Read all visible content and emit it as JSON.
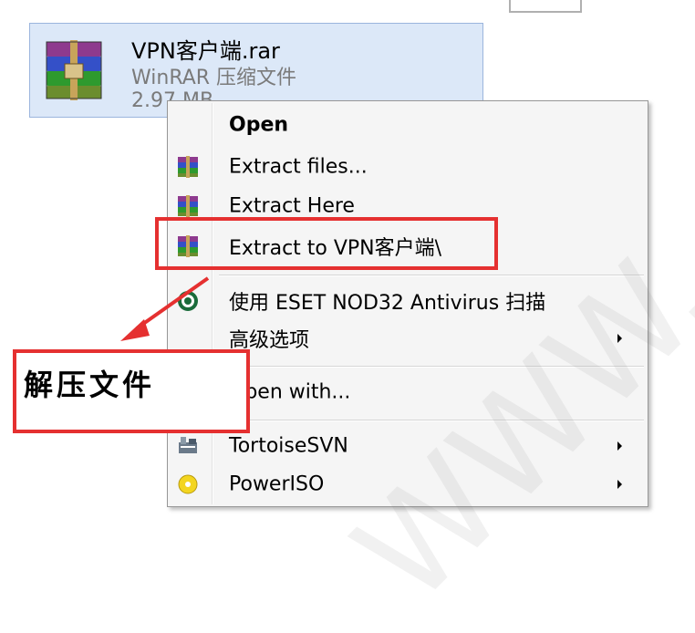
{
  "file": {
    "name": "VPN客户端.rar",
    "type": "WinRAR 压缩文件",
    "size": "2.97 MB",
    "icon": "winrar-archive-icon"
  },
  "context_menu": {
    "items": [
      {
        "label": "Open",
        "bold": true
      },
      {
        "label": "Extract files...",
        "icon": "winrar-icon"
      },
      {
        "label": "Extract Here",
        "icon": "winrar-icon"
      },
      {
        "label": "Extract to VPN客户端\\",
        "icon": "winrar-icon"
      },
      {
        "label": "使用 ESET NOD32 Antivirus 扫描",
        "icon": "eset-icon"
      },
      {
        "label": "高级选项",
        "submenu": true
      },
      {
        "label": "Open with...",
        "icon": "open-with-icon"
      },
      {
        "label": "TortoiseSVN",
        "icon": "tortoisesvn-icon",
        "submenu": true
      },
      {
        "label": "PowerISO",
        "icon": "poweriso-icon",
        "submenu": true
      }
    ]
  },
  "annotation": {
    "callout_text": "解压文件",
    "color": "#e53030"
  },
  "watermark": "WWW. Sun"
}
